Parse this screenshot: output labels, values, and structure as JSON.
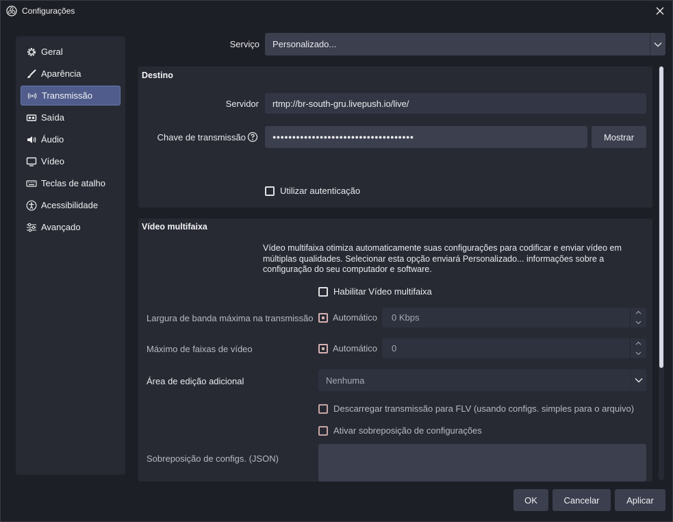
{
  "window": {
    "title": "Configurações"
  },
  "sidebar": {
    "items": [
      {
        "label": "Geral",
        "icon": "gear-icon"
      },
      {
        "label": "Aparência",
        "icon": "brush-icon"
      },
      {
        "label": "Transmissão",
        "icon": "broadcast-icon",
        "active": true
      },
      {
        "label": "Saída",
        "icon": "output-icon"
      },
      {
        "label": "Áudio",
        "icon": "speaker-icon"
      },
      {
        "label": "Vídeo",
        "icon": "monitor-icon"
      },
      {
        "label": "Teclas de atalho",
        "icon": "keyboard-icon"
      },
      {
        "label": "Acessibilidade",
        "icon": "accessibility-icon"
      },
      {
        "label": "Avançado",
        "icon": "sliders-icon"
      }
    ]
  },
  "service": {
    "label": "Serviço",
    "value": "Personalizado..."
  },
  "destination": {
    "title": "Destino",
    "server_label": "Servidor",
    "server_value": "rtmp://br-south-gru.livepush.io/live/",
    "key_label": "Chave de transmissão",
    "key_value": "●●●●●●●●●●●●●●●●●●●●●●●●●●●●●●●●●●●●",
    "show_button": "Mostrar",
    "auth_label": "Utilizar autenticação"
  },
  "multitrack": {
    "title": "Vídeo multifaixa",
    "description": "Vídeo multifaixa otimiza automaticamente suas configurações para codificar e enviar vídeo em múltiplas qualidades. Selecionar esta opção enviará Personalizado... informações sobre a configuração do seu computador e software.",
    "enable_label": "Habilitar Vídeo multifaixa",
    "bandwidth_label": "Largura de banda máxima na transmissão",
    "bandwidth_auto": "Automático",
    "bandwidth_value": "0 Kbps",
    "tracks_label": "Máximo de faixas de vídeo",
    "tracks_auto": "Automático",
    "tracks_value": "0",
    "canvas_label": "Área de edição adicional",
    "canvas_value": "Nenhuma",
    "dump_label": "Descarregar transmissão para FLV (usando configs. simples para o arquivo)",
    "override_label": "Ativar sobreposição de configurações",
    "json_label": "Sobreposição de configs. (JSON)"
  },
  "buttons": {
    "ok": "OK",
    "cancel": "Cancelar",
    "apply": "Aplicar"
  }
}
